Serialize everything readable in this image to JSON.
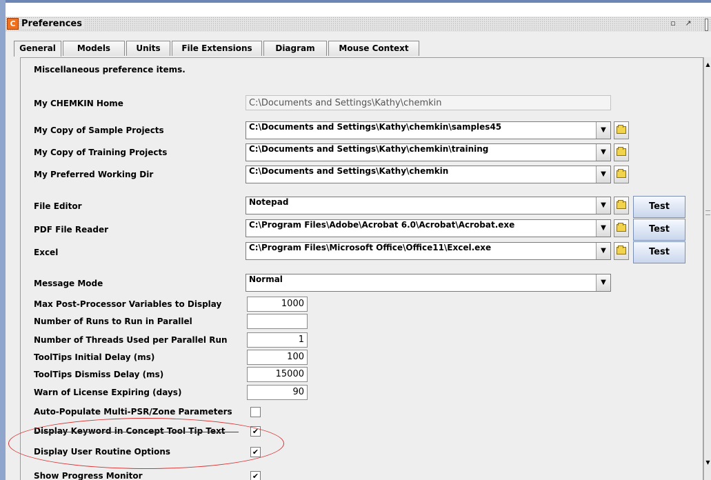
{
  "window": {
    "title": "Preferences",
    "app_icon_letter": "C",
    "minimize_glyph": "▫",
    "maximize_glyph": "↗"
  },
  "tabs": [
    "General",
    "Models",
    "Units",
    "File Extensions",
    "Diagram",
    "Mouse Context"
  ],
  "active_tab": "General",
  "description": "Miscellaneous preference items.",
  "home": {
    "label": "My CHEMKIN Home",
    "value": "C:\\Documents and Settings\\Kathy\\chemkin"
  },
  "paths": [
    {
      "label": "My Copy of Sample Projects",
      "value": "C:\\Documents and Settings\\Kathy\\chemkin\\samples45"
    },
    {
      "label": "My Copy of Training Projects",
      "value": "C:\\Documents and Settings\\Kathy\\chemkin\\training"
    },
    {
      "label": "My Preferred Working Dir",
      "value": "C:\\Documents and Settings\\Kathy\\chemkin"
    }
  ],
  "apps": [
    {
      "label": "File Editor",
      "value": "Notepad",
      "button": "Test"
    },
    {
      "label": "PDF File Reader",
      "value": "C:\\Program Files\\Adobe\\Acrobat 6.0\\Acrobat\\Acrobat.exe",
      "button": "Test"
    },
    {
      "label": "Excel",
      "value": "C:\\Program Files\\Microsoft Office\\Office11\\Excel.exe",
      "button": "Test"
    }
  ],
  "message_mode": {
    "label": "Message Mode",
    "value": "Normal"
  },
  "numeric": [
    {
      "label": "Max Post-Processor Variables to Display",
      "value": "1000"
    },
    {
      "label": "Number of Runs to Run in Parallel",
      "value": ""
    },
    {
      "label": "Number of Threads Used per Parallel Run",
      "value": "1"
    },
    {
      "label": "ToolTips Initial Delay (ms)",
      "value": "100"
    },
    {
      "label": "ToolTips Dismiss Delay (ms)",
      "value": "15000"
    },
    {
      "label": "Warn of License Expiring (days)",
      "value": "90"
    }
  ],
  "checkboxes": [
    {
      "label": "Auto-Populate Multi-PSR/Zone Parameters",
      "checked": false,
      "mark": ""
    },
    {
      "label": "Display Keyword in Concept Tool Tip Text",
      "checked": true,
      "mark": "✔"
    },
    {
      "label": "Display User Routine Options",
      "checked": true,
      "mark": "✔"
    },
    {
      "label": "Show Progress Monitor",
      "checked": true,
      "mark": "✔"
    }
  ],
  "annotation_color": "#d93030",
  "icons": {
    "folder": "folder-browse-icon",
    "dropdown": "chevron-down-icon",
    "scroll_up": "▲",
    "scroll_down": "▼"
  }
}
